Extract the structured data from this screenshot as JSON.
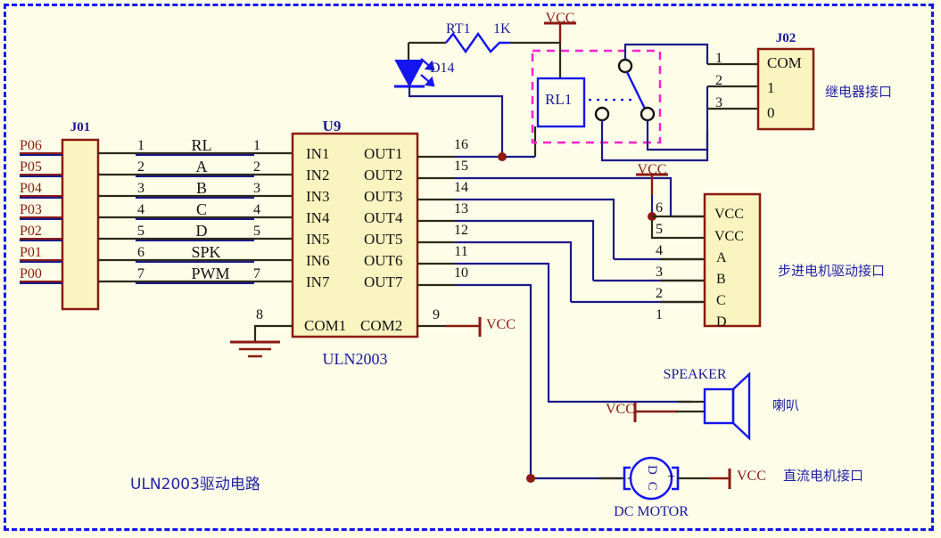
{
  "diagram": {
    "title": "ULN2003驱动电路",
    "background": "#FDFDE8",
    "border_color": "#1414F0",
    "wire_color": "#1A1A8C",
    "pin_color": "#2A2A18",
    "body_fill": "#FAF5C0",
    "body_stroke": "#8B1A10",
    "label_navy": "#1A1A9B",
    "label_dred": "#8B1A10",
    "relay_dash": "#FF20D0"
  },
  "connector_j01": {
    "ref": "J01",
    "nets": [
      "P06",
      "P05",
      "P04",
      "P03",
      "P02",
      "P01",
      "P00"
    ],
    "left_pins": [
      "1",
      "2",
      "3",
      "4",
      "5",
      "6",
      "7"
    ],
    "wire_labels": [
      "RL",
      "A",
      "B",
      "C",
      "D",
      "SPK",
      "PWM"
    ],
    "right_pins": [
      "1",
      "2",
      "3",
      "4",
      "5",
      "",
      "7"
    ]
  },
  "ic_u9": {
    "ref": "U9",
    "part": "ULN2003",
    "inputs": [
      "IN1",
      "IN2",
      "IN3",
      "IN4",
      "IN5",
      "IN6",
      "IN7"
    ],
    "outputs": [
      "OUT1",
      "OUT2",
      "OUT3",
      "OUT4",
      "OUT5",
      "OUT6",
      "OUT7"
    ],
    "out_pins": [
      "16",
      "15",
      "14",
      "13",
      "12",
      "11",
      "10"
    ],
    "com_left": "COM1",
    "com_right": "COM2",
    "com_left_pin": "8",
    "com_right_pin": "9",
    "com_right_net": "VCC"
  },
  "relay_block": {
    "resistor_ref": "RT1",
    "resistor_value": "1K",
    "diode_ref": "D14",
    "coil_ref": "RL1",
    "vcc_label": "VCC",
    "contact_pins": [
      "1",
      "2",
      "3"
    ]
  },
  "connector_j02": {
    "ref": "J02",
    "pins": [
      "COM",
      "1",
      "0"
    ],
    "annotation": "继电器接口"
  },
  "connector_stepper": {
    "pin_numbers": [
      "6",
      "5",
      "4",
      "3",
      "2",
      "1"
    ],
    "pin_labels": [
      "VCC",
      "VCC",
      "A",
      "B",
      "C",
      "D"
    ],
    "vcc_label": "VCC",
    "annotation": "步进电机驱动接口"
  },
  "speaker": {
    "label": "SPEAKER",
    "vcc_label": "VCC",
    "annotation": "喇叭"
  },
  "dc_motor": {
    "label": "DC MOTOR",
    "inner_text": "D C",
    "minus": "-",
    "plus": "+",
    "vcc_label": "VCC",
    "annotation": "直流电机接口"
  }
}
